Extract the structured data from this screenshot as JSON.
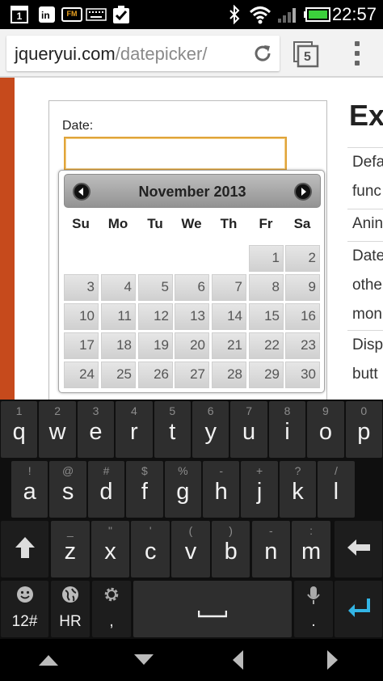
{
  "status_bar": {
    "time": "22:57",
    "notif_badge": "1",
    "notif_fm": "FM"
  },
  "browser": {
    "url_host": "jqueryui.com",
    "url_path": "/datepicker/",
    "tab_count": "5"
  },
  "page": {
    "date_label": "Date:",
    "date_value": "",
    "section_title": "Ex",
    "sidebar_rows": [
      {
        "lines": [
          "Defa",
          "func"
        ]
      },
      {
        "lines": [
          "Anin"
        ]
      },
      {
        "lines": [
          "Date",
          "othe",
          "mon"
        ]
      },
      {
        "lines": [
          "Disp",
          "butt"
        ]
      }
    ]
  },
  "datepicker": {
    "title": "November 2013",
    "weekdays": [
      "Su",
      "Mo",
      "Tu",
      "We",
      "Th",
      "Fr",
      "Sa"
    ],
    "weeks": [
      [
        "",
        "",
        "",
        "",
        "",
        "1",
        "2"
      ],
      [
        "3",
        "4",
        "5",
        "6",
        "7",
        "8",
        "9"
      ],
      [
        "10",
        "11",
        "12",
        "13",
        "14",
        "15",
        "16"
      ],
      [
        "17",
        "18",
        "19",
        "20",
        "21",
        "22",
        "23"
      ],
      [
        "24",
        "25",
        "26",
        "27",
        "28",
        "29",
        "30"
      ]
    ]
  },
  "keyboard": {
    "row1": [
      {
        "hint": "1",
        "main": "q"
      },
      {
        "hint": "2",
        "main": "w"
      },
      {
        "hint": "3",
        "main": "e"
      },
      {
        "hint": "4",
        "main": "r"
      },
      {
        "hint": "5",
        "main": "t"
      },
      {
        "hint": "6",
        "main": "y"
      },
      {
        "hint": "7",
        "main": "u"
      },
      {
        "hint": "8",
        "main": "i"
      },
      {
        "hint": "9",
        "main": "o"
      },
      {
        "hint": "0",
        "main": "p"
      }
    ],
    "row2": [
      {
        "hint": "!",
        "main": "a"
      },
      {
        "hint": "@",
        "main": "s"
      },
      {
        "hint": "#",
        "main": "d"
      },
      {
        "hint": "$",
        "main": "f"
      },
      {
        "hint": "%",
        "main": "g"
      },
      {
        "hint": "-",
        "main": "h"
      },
      {
        "hint": "+",
        "main": "j"
      },
      {
        "hint": "?",
        "main": "k"
      },
      {
        "hint": "/",
        "main": "l"
      }
    ],
    "row3": [
      {
        "hint": "_",
        "main": "z"
      },
      {
        "hint": "\"",
        "main": "x"
      },
      {
        "hint": "'",
        "main": "c"
      },
      {
        "hint": "(",
        "main": "v"
      },
      {
        "hint": ")",
        "main": "b"
      },
      {
        "hint": "-",
        "main": "n"
      },
      {
        "hint": ":",
        "main": "m"
      }
    ],
    "symbols_label": "12#",
    "language_label": "HR",
    "comma_label": ",",
    "period_label": ".",
    "icons": {
      "shift": "shift-arrow-icon",
      "backspace": "backspace-icon",
      "emoji": "emoji-icon",
      "globe": "globe-icon",
      "settings": "gear-icon",
      "mic": "microphone-icon",
      "enter": "enter-arrow-icon",
      "enter_color": "#33b5e5"
    }
  },
  "colors": {
    "accent_stripe": "#c64a1c",
    "input_focus": "#e0a43a",
    "battery": "#3ccf3c"
  }
}
